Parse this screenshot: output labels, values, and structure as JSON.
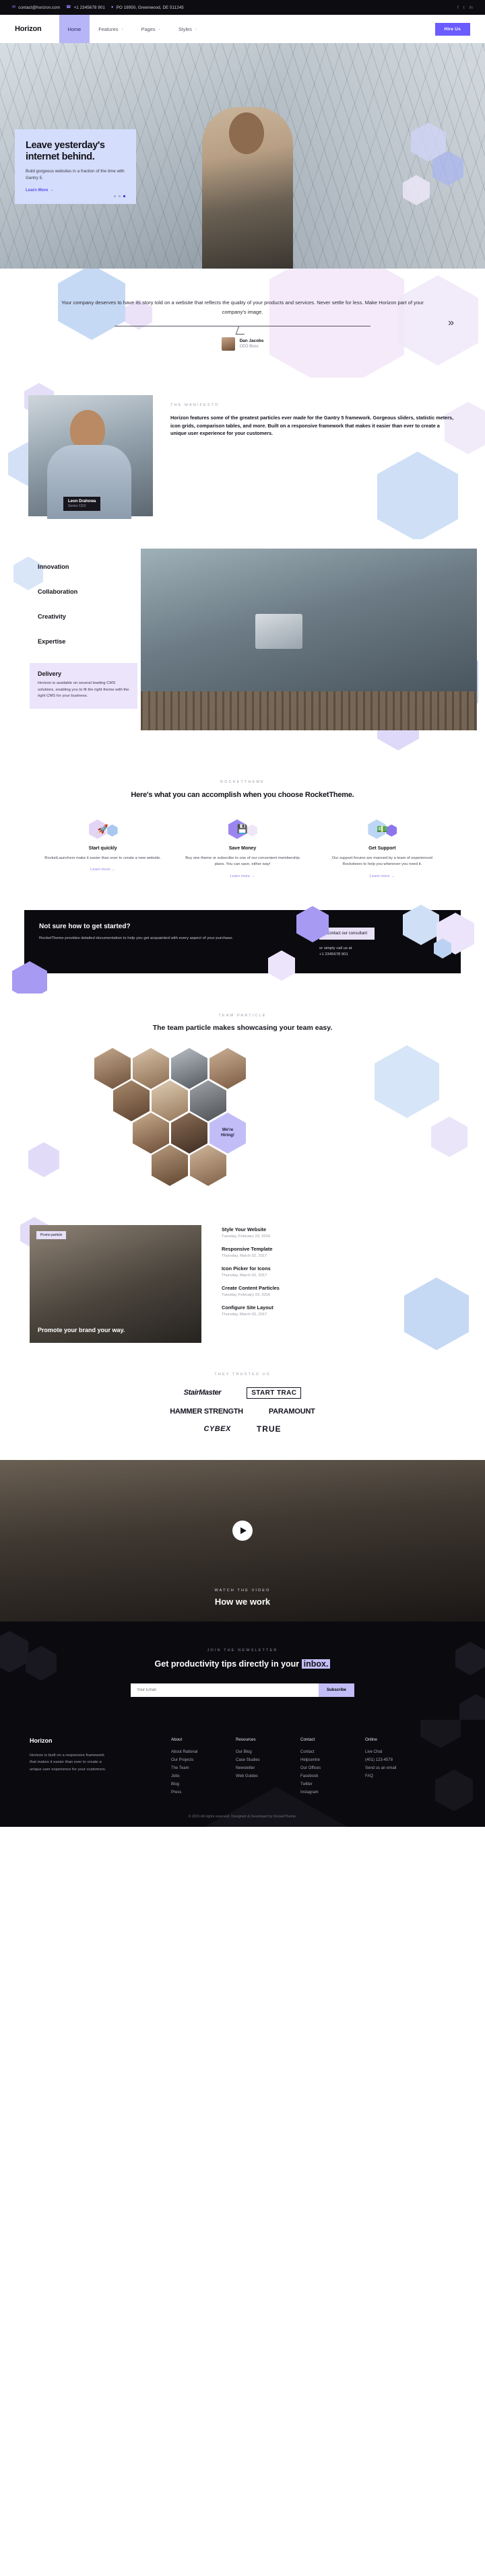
{
  "topbar": {
    "email": "contact@horizon.com",
    "email_icon": "envelope-icon",
    "phone": "+1 2345678 901",
    "phone_icon": "phone-icon",
    "address": "PO 19950, Greenwood, DE 511245",
    "address_icon": "map-pin-icon",
    "social": [
      "f",
      "t",
      "in"
    ]
  },
  "nav": {
    "brand": "Horizon",
    "items": [
      {
        "label": "Home",
        "active": true,
        "caret": ""
      },
      {
        "label": "Features",
        "active": false,
        "caret": "⌄"
      },
      {
        "label": "Pages",
        "active": false,
        "caret": "⌄"
      },
      {
        "label": "Styles",
        "active": false,
        "caret": "⌄"
      }
    ],
    "cta": "Hire Us"
  },
  "hero": {
    "title": "Leave yesterday's internet behind.",
    "subtitle": "Build gorgeous websites in a fraction of the time with Gantry 5.",
    "link": "Learn More →",
    "slides": 3,
    "active_slide": 3
  },
  "testimonial": {
    "quote": "Your company deserves to have its story told on a website that reflects the quality of your products and services. Never settle for less. Make Horizon part of your company's image.",
    "name": "Dan Jacobs",
    "role": "CEO Boss",
    "prev_icon": "chevron-left-double-icon",
    "next_icon": "chevron-right-double-icon"
  },
  "manifesto": {
    "eyebrow": "THE MANIFESTO",
    "body": "Horizon features some of the greatest particles ever made for the Gantry 5 framework. Gorgeous sliders, statistic meters, icon grids, comparison tables, and more. Built on a responsive framework that makes it easier than ever to create a unique user experience for your customers.",
    "photo_name": "Leon Drahowa",
    "photo_role": "Senior CEO"
  },
  "tabs": {
    "items": [
      {
        "label": "Innovation"
      },
      {
        "label": "Collaboration"
      },
      {
        "label": "Creativity"
      },
      {
        "label": "Expertise"
      }
    ],
    "open": {
      "label": "Delivery",
      "body": "Horizon is available on several leading CMS solutions, enabling you to fit the right theme with the right CMS for your business."
    }
  },
  "rocket": {
    "eyebrow": "ROCKETTHEME",
    "heading": "Here's what you can accomplish when you choose RocketTheme.",
    "columns": [
      {
        "icon": "rocket-icon",
        "glyph": "🚀",
        "title": "Start quickly",
        "body": "RocketLaunchers make it easier than ever to create a new website.",
        "link": "Learn more →",
        "hex1": "#e3d4f3",
        "hex2": "#a9c8ef"
      },
      {
        "icon": "floppy-disk-icon",
        "glyph": "💾",
        "title": "Save Money",
        "body": "Buy one theme or subscribe to one of our convenient membership plans. You can save, either way!",
        "link": "Learn more →",
        "hex1": "#9b86f0",
        "hex2": "#efe6f8"
      },
      {
        "icon": "money-icon",
        "glyph": "💵",
        "title": "Get Support",
        "body": "Our support forums are manned by a team of experienced Rocketeers to help you whenever you need it.",
        "link": "Learn more →",
        "hex1": "#bdd6f6",
        "hex2": "#8c76ec"
      }
    ]
  },
  "cta": {
    "heading": "Not sure how to get started?",
    "body": "RocketTheme provides detailed documentation to help you get acquainted with every aspect of your purchase.",
    "button": "Contact our consultant",
    "call_label": "or simply call us at",
    "phone": "+1 2345678 901"
  },
  "team": {
    "eyebrow": "TEAM PARTICLE",
    "heading": "The team particle makes showcasing your team easy.",
    "hiring_line1": "We're",
    "hiring_line2": "Hiring!",
    "members": [
      {
        "tone": "#8e6f55"
      },
      {
        "tone": "#c0a88f"
      },
      {
        "tone": "#6d6f78"
      },
      {
        "tone": "#9a7a5f"
      },
      {
        "tone": "#7b5e46"
      },
      {
        "tone": "#b59a7d"
      },
      {
        "tone": "#5e5a56"
      },
      {
        "tone": "#a98b6d"
      },
      {
        "tone": "#6b5344"
      },
      {
        "tone": "#8a7866"
      },
      {
        "tone": "#93766a"
      }
    ]
  },
  "blog": {
    "badge": "Promo particle",
    "caption": "Promote your brand your way.",
    "posts": [
      {
        "title": "Style Your Website",
        "date": "Tuesday, February 23, 2016"
      },
      {
        "title": "Responsive Template",
        "date": "Thursday, March 02, 2017"
      },
      {
        "title": "Icon Picker for Icons",
        "date": "Thursday, March 02, 2017"
      },
      {
        "title": "Create Content Particles",
        "date": "Tuesday, February 23, 2016"
      },
      {
        "title": "Configure Site Layout",
        "date": "Thursday, March 02, 2017"
      }
    ]
  },
  "logos": {
    "eyebrow": "THEY TRUSTED US",
    "row1": [
      "StairMaster",
      "START TRAC"
    ],
    "row2": [
      "HAMMER STRENGTH",
      "PARAMOUNT"
    ],
    "row3": [
      "CYBEX",
      "TRUE"
    ]
  },
  "video": {
    "eyebrow": "WATCH THE VIDEO",
    "heading": "How we work",
    "play_icon": "play-icon"
  },
  "newsletter": {
    "eyebrow": "JOIN THE NEWSLETTER",
    "heading_pre": "Get productivity tips directly in your ",
    "heading_mark": "inbox.",
    "placeholder": "Your Email",
    "button": "Subscribe"
  },
  "footer": {
    "brand": "Horizon",
    "about": "Horizon is built on a responsive framework that makes it easier than ever to create a unique user experience for your customers.",
    "columns": [
      {
        "title": "About",
        "links": [
          "About Rational",
          "Our Projects",
          "The Team",
          "Jobs",
          "Blog",
          "Press"
        ]
      },
      {
        "title": "Resources",
        "links": [
          "Our Blog",
          "Case Studies",
          "Newsletter",
          "Web Guides"
        ]
      },
      {
        "title": "Contact",
        "links": [
          "Contact",
          "Helpcentre",
          "Our Offices",
          "Facebook",
          "Twitter",
          "Instagram"
        ]
      },
      {
        "title": "Online",
        "links": [
          "Live Chat",
          "(401) 123-4578",
          "Send us an email",
          "FAQ"
        ]
      }
    ],
    "copyright": "© 2021 All rights reserved. Designed & Developed by RocketTheme."
  },
  "colors": {
    "accent": "#6b5cff",
    "lavender": "#c3bdf7",
    "pale_blue": "#d4ddfb",
    "pale_purple": "#ece4fb",
    "dark": "#0b0a0f"
  }
}
